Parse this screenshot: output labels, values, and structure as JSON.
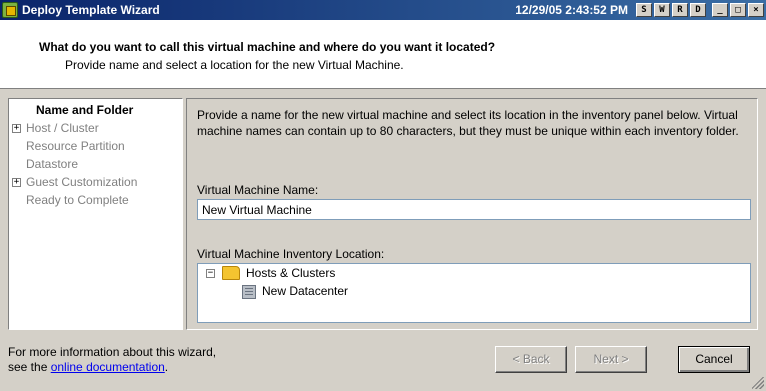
{
  "window": {
    "title": "Deploy Template Wizard",
    "clock": "12/29/05 2:43:52 PM",
    "controls": [
      "S",
      "W",
      "R",
      "D",
      "_",
      "□",
      "×"
    ]
  },
  "header": {
    "title": "What do you want to call this virtual machine and where do you want it located?",
    "subtitle": "Provide name and select a location for the new Virtual Machine."
  },
  "steps": [
    {
      "label": "Name and Folder",
      "active": true,
      "expandable": false
    },
    {
      "label": "Host / Cluster",
      "active": false,
      "expandable": true
    },
    {
      "label": "Resource Partition",
      "active": false,
      "expandable": false
    },
    {
      "label": "Datastore",
      "active": false,
      "expandable": false
    },
    {
      "label": "Guest Customization",
      "active": false,
      "expandable": true
    },
    {
      "label": "Ready to Complete",
      "active": false,
      "expandable": false
    }
  ],
  "content": {
    "description": "Provide a name for the new virtual machine and select its location in the inventory panel below. Virtual machine names can contain up to 80 characters, but they must be unique within each inventory folder.",
    "vm_name_label": "Virtual Machine Name:",
    "vm_name_value": "New Virtual Machine",
    "location_label": "Virtual Machine Inventory Location:",
    "tree": {
      "root": "Hosts & Clusters",
      "child": "New Datacenter",
      "root_expander": "−"
    }
  },
  "footer": {
    "text_before": "For more information about this wizard,",
    "text_see": "see the ",
    "link": "online documentation",
    "text_after": "."
  },
  "buttons": {
    "back": "< Back",
    "next": "Next >",
    "cancel": "Cancel"
  }
}
